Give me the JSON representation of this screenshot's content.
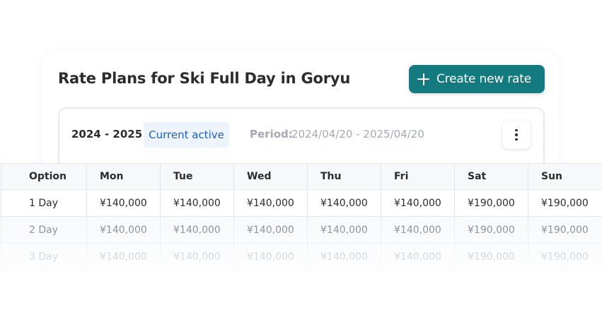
{
  "header": {
    "title": "Rate Plans for Ski Full Day in Goryu",
    "create_button_label": "Create new rate",
    "create_button_icon": "plus-icon",
    "accent_color": "#137a80"
  },
  "season": {
    "year_range": "2024 - 2025",
    "status_badge": "Current active",
    "period_label": "Period:",
    "period_value": "2024/04/20 - 2025/04/20",
    "menu_icon": "more-vertical-icon"
  },
  "table": {
    "columns": [
      "Option",
      "Mon",
      "Tue",
      "Wed",
      "Thu",
      "Fri",
      "Sat",
      "Sun"
    ],
    "rows": [
      [
        "1 Day",
        "¥140,000",
        "¥140,000",
        "¥140,000",
        "¥140,000",
        "¥140,000",
        "¥190,000",
        "¥190,000"
      ],
      [
        "2 Day",
        "¥140,000",
        "¥140,000",
        "¥140,000",
        "¥140,000",
        "¥140,000",
        "¥190,000",
        "¥190,000"
      ],
      [
        "3 Day",
        "¥140,000",
        "¥140,000",
        "¥140,000",
        "¥140,000",
        "¥140,000",
        "¥190,000",
        "¥190,000"
      ]
    ]
  }
}
